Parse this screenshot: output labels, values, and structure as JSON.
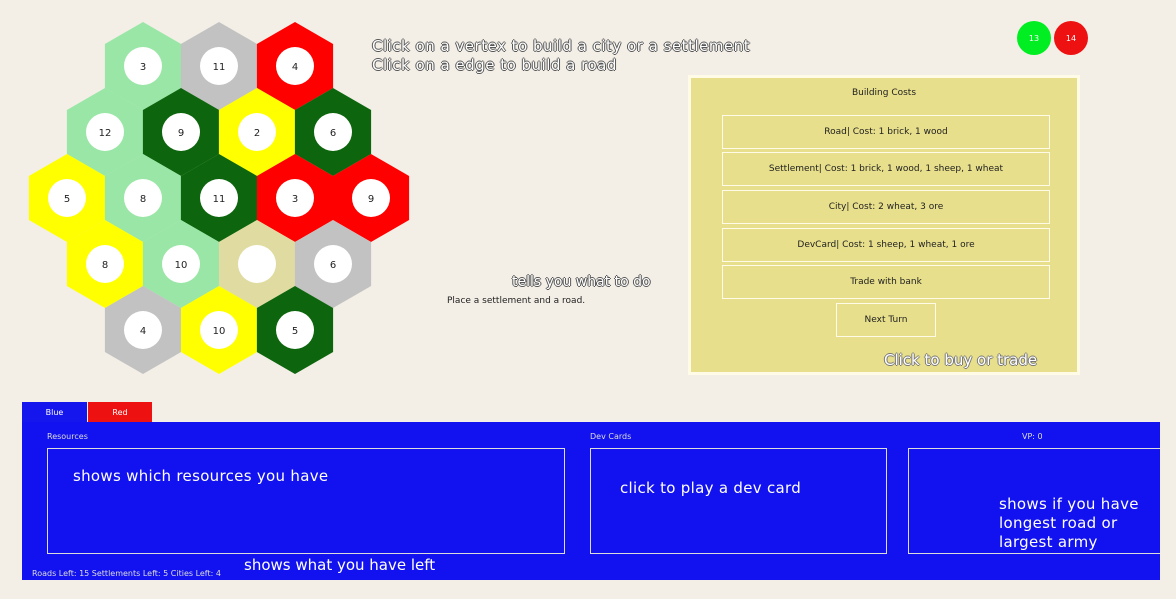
{
  "colors": {
    "light_green": "#99e6a6",
    "gray": "#c2c2c2",
    "red": "#ff0000",
    "dark_green": "#0d660d",
    "yellow": "#ffff00",
    "desert": "#e0dba0",
    "panel_blue": "#1212f0",
    "costs_bg": "#e7df8b"
  },
  "board": {
    "hexes": [
      {
        "color": "light_green",
        "number": "3"
      },
      {
        "color": "gray",
        "number": "11"
      },
      {
        "color": "red",
        "number": "4"
      },
      {
        "color": "light_green",
        "number": "12"
      },
      {
        "color": "dark_green",
        "number": "9"
      },
      {
        "color": "yellow",
        "number": "2"
      },
      {
        "color": "dark_green",
        "number": "6"
      },
      {
        "color": "yellow",
        "number": "5"
      },
      {
        "color": "light_green",
        "number": "8"
      },
      {
        "color": "dark_green",
        "number": "11"
      },
      {
        "color": "red",
        "number": "3"
      },
      {
        "color": "red",
        "number": "9"
      },
      {
        "color": "yellow",
        "number": "8"
      },
      {
        "color": "light_green",
        "number": "10"
      },
      {
        "color": "desert",
        "number": ""
      },
      {
        "color": "gray",
        "number": "6"
      },
      {
        "color": "gray",
        "number": "4"
      },
      {
        "color": "yellow",
        "number": "10"
      },
      {
        "color": "dark_green",
        "number": "5"
      }
    ]
  },
  "instructions": {
    "line1": "Click on a vertex to build a city or a settlement",
    "line2": "Click on a edge to build a road"
  },
  "players_dots": {
    "green_label": "13",
    "red_label": "14"
  },
  "status": {
    "tells_label": "tells you what to do",
    "message": "Place a settlement and a road."
  },
  "costs": {
    "title": "Building Costs",
    "road": "Road| Cost: 1 brick, 1 wood",
    "settlement": "Settlement| Cost: 1 brick, 1 wood, 1 sheep, 1 wheat",
    "city": "City| Cost: 2 wheat, 3 ore",
    "devcard": "DevCard| Cost: 1 sheep, 1 wheat, 1 ore",
    "trade": "Trade with bank",
    "next_turn": "Next Turn",
    "buy_label": "Click to buy or trade"
  },
  "tabs": {
    "blue": "Blue",
    "red": "Red"
  },
  "panel": {
    "resources_label": "Resources",
    "devcards_label": "Dev Cards",
    "vp_label": "VP: 0",
    "resources_help": "shows which resources you have",
    "devcards_help": "click to play a dev card",
    "vp_help_1": "shows if you have",
    "vp_help_2": "longest road or",
    "vp_help_3": "largest army",
    "left_help": "shows what you have left",
    "pieces_left": "Roads Left: 15 Settlements Left: 5 Cities Left: 4"
  }
}
